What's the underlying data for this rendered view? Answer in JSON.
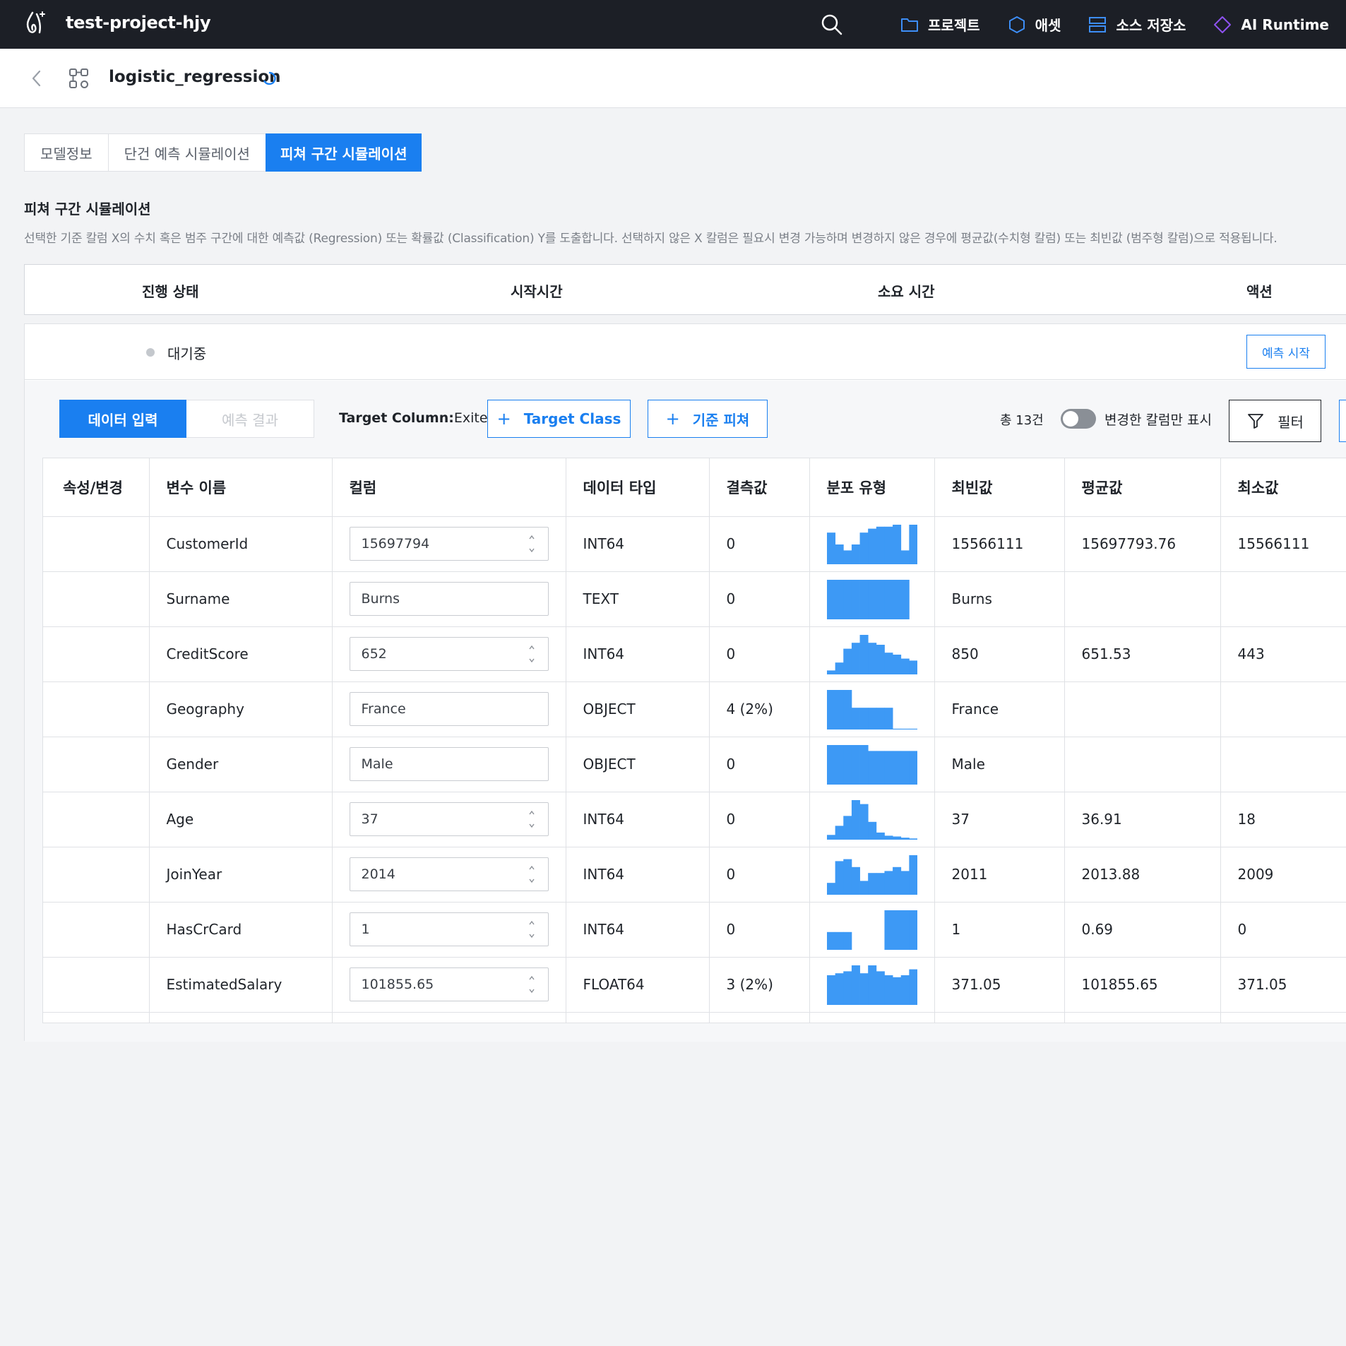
{
  "topbar": {
    "project_name": "test-project-hjy",
    "nav": [
      {
        "label": "프로젝트",
        "icon": "folder-icon"
      },
      {
        "label": "애셋",
        "icon": "hexagon-icon"
      },
      {
        "label": "소스 저장소",
        "icon": "database-icon"
      },
      {
        "label": "AI Runtime",
        "icon": "diamond-icon"
      }
    ]
  },
  "header": {
    "model_name": "logistic_regression"
  },
  "tabs": [
    {
      "label": "모델정보",
      "active": false
    },
    {
      "label": "단건 예측 시뮬레이션",
      "active": false
    },
    {
      "label": "피쳐 구간 시뮬레이션",
      "active": true
    }
  ],
  "section": {
    "title": "피쳐 구간 시뮬레이션",
    "description": "선택한 기준 칼럼 X의 수치 혹은 범주 구간에 대한 예측값 (Regression) 또는 확률값 (Classification) Y를 도출합니다. 선택하지 않은 X 칼럼은 필요시 변경 가능하며 변경하지 않은 경우에 평균값(수치형 칼럼) 또는 최빈값 (범주형 칼럼)으로 적용됩니다."
  },
  "status_table": {
    "headers": [
      "진행 상태",
      "시작시간",
      "소요 시간",
      "액션"
    ],
    "status": "대기중",
    "action_label": "예측 시작"
  },
  "toolbar": {
    "segment": [
      "데이터 입력",
      "예측 결과"
    ],
    "target_column_label": "Target Column:",
    "target_column_value": "Exited",
    "target_class_label": "Target Class",
    "base_feature_label": "기준 피쳐",
    "count_label": "총 13건",
    "toggle_label": "변경한 칼럼만 표시",
    "filter_label": "필터"
  },
  "grid": {
    "headers": [
      "속성/변경",
      "변수 이름",
      "컬럼",
      "데이터 타입",
      "결측값",
      "분포 유형",
      "최빈값",
      "평균값",
      "최소값"
    ],
    "rows": [
      {
        "name": "CustomerId",
        "value": "15697794",
        "numeric": true,
        "dtype": "INT64",
        "missing": "0",
        "hist": [
          0.8,
          0.5,
          0.35,
          0.5,
          0.8,
          0.9,
          0.95,
          0.95,
          1,
          0.35,
          1
        ],
        "mode": "15566111",
        "mean": "15697793.76",
        "min": "15566111"
      },
      {
        "name": "Surname",
        "value": "Burns",
        "numeric": false,
        "dtype": "TEXT",
        "missing": "0",
        "hist": [
          1,
          1,
          1,
          1,
          1,
          1,
          1,
          1,
          1,
          1,
          0
        ],
        "mode": "Burns",
        "mean": "",
        "min": ""
      },
      {
        "name": "CreditScore",
        "value": "652",
        "numeric": true,
        "dtype": "INT64",
        "missing": "0",
        "hist": [
          0.1,
          0.3,
          0.65,
          0.8,
          1,
          0.8,
          0.75,
          0.55,
          0.5,
          0.4,
          0.35
        ],
        "mode": "850",
        "mean": "651.53",
        "min": "443"
      },
      {
        "name": "Geography",
        "value": "France",
        "numeric": false,
        "dtype": "OBJECT",
        "missing": "4 (2%)",
        "hist": [
          1,
          1,
          1,
          0.55,
          0.55,
          0.55,
          0.55,
          0.55,
          0.02,
          0.02,
          0.02
        ],
        "mode": "France",
        "mean": "",
        "min": ""
      },
      {
        "name": "Gender",
        "value": "Male",
        "numeric": false,
        "dtype": "OBJECT",
        "missing": "0",
        "hist": [
          1,
          1,
          1,
          1,
          1,
          0.85,
          0.85,
          0.85,
          0.85,
          0.85,
          0.85
        ],
        "mode": "Male",
        "mean": "",
        "min": ""
      },
      {
        "name": "Age",
        "value": "37",
        "numeric": true,
        "dtype": "INT64",
        "missing": "0",
        "hist": [
          0.12,
          0.35,
          0.6,
          1,
          0.9,
          0.45,
          0.18,
          0.1,
          0.08,
          0.05,
          0.03
        ],
        "mode": "37",
        "mean": "36.91",
        "min": "18"
      },
      {
        "name": "JoinYear",
        "value": "2014",
        "numeric": true,
        "dtype": "INT64",
        "missing": "0",
        "hist": [
          0.3,
          0.85,
          0.9,
          0.7,
          0.35,
          0.55,
          0.55,
          0.6,
          0.7,
          0.6,
          1
        ],
        "mode": "2011",
        "mean": "2013.88",
        "min": "2009"
      },
      {
        "name": "HasCrCard",
        "value": "1",
        "numeric": true,
        "dtype": "INT64",
        "missing": "0",
        "hist": [
          0.45,
          0.45,
          0.45,
          0,
          0,
          0,
          0,
          1,
          1,
          1,
          1
        ],
        "mode": "1",
        "mean": "0.69",
        "min": "0"
      },
      {
        "name": "EstimatedSalary",
        "value": "101855.65",
        "numeric": true,
        "dtype": "FLOAT64",
        "missing": "3 (2%)",
        "hist": [
          0.75,
          0.8,
          0.85,
          1,
          0.8,
          1,
          0.85,
          0.75,
          0.7,
          0.75,
          0.9
        ],
        "mode": "371.05",
        "mean": "101855.65",
        "min": "371.05"
      }
    ]
  }
}
